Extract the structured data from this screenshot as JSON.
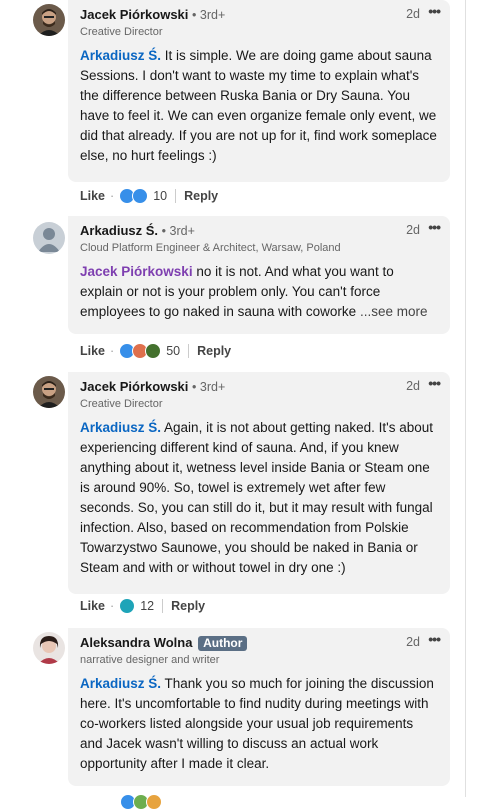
{
  "comments": [
    {
      "author": "Jacek Piórkowski",
      "degree": "• 3rd+",
      "subtitle": "Creative Director",
      "time": "2d",
      "mention": "Arkadiusz Ś.",
      "text": " It is simple. We are doing game about sauna Sessions. I don't want to waste my time to explain what's the difference between Ruska Bania or Dry Sauna. You have to feel it. We can even organize female only event, we did that already. If you are not up for it, find work someplace else, no hurt feelings :)",
      "like_label": "Like",
      "reaction_count": "10",
      "reply_label": "Reply",
      "reactions": [
        "#378fe9",
        "#378fe9"
      ]
    },
    {
      "author": "Arkadiusz Ś.",
      "degree": "• 3rd+",
      "subtitle": "Cloud Platform Engineer & Architect, Warsaw, Poland",
      "time": "2d",
      "mention": "Jacek Piórkowski",
      "text": " no it is not. And what you want to explain or not is your problem only. You can't force employees to go naked in sauna with coworke",
      "see_more": "...see more",
      "like_label": "Like",
      "reaction_count": "50",
      "reply_label": "Reply",
      "reactions": [
        "#378fe9",
        "#df704d",
        "#44712e"
      ]
    },
    {
      "author": "Jacek Piórkowski",
      "degree": "• 3rd+",
      "subtitle": "Creative Director",
      "time": "2d",
      "mention": "Arkadiusz Ś.",
      "text": " Again, it is not about getting naked. It's about experiencing different kind of sauna. And, if you knew anything about it, wetness level inside Bania or Steam one is around 90%. So, towel is extremely wet after few seconds. So, you can still do it, but it may result with fungal infection. Also, based on recommendation from Polskie Towarzystwo Saunowe, you should be naked in Bania or Steam and with or without towel in dry one :)",
      "like_label": "Like",
      "reaction_count": "12",
      "reply_label": "Reply",
      "reactions": [
        "#1ea4b8"
      ]
    },
    {
      "author": "Aleksandra Wolna",
      "badge": "Author",
      "subtitle": "narrative designer and writer",
      "time": "2d",
      "mention": "Arkadiusz Ś.",
      "text": " Thank you so much for joining the discussion here. It's uncomfortable to find nudity during meetings with co-workers listed alongside your usual job requirements and Jacek wasn't willing to discuss an actual work opportunity after I made it clear."
    }
  ],
  "more_glyph": "•••"
}
